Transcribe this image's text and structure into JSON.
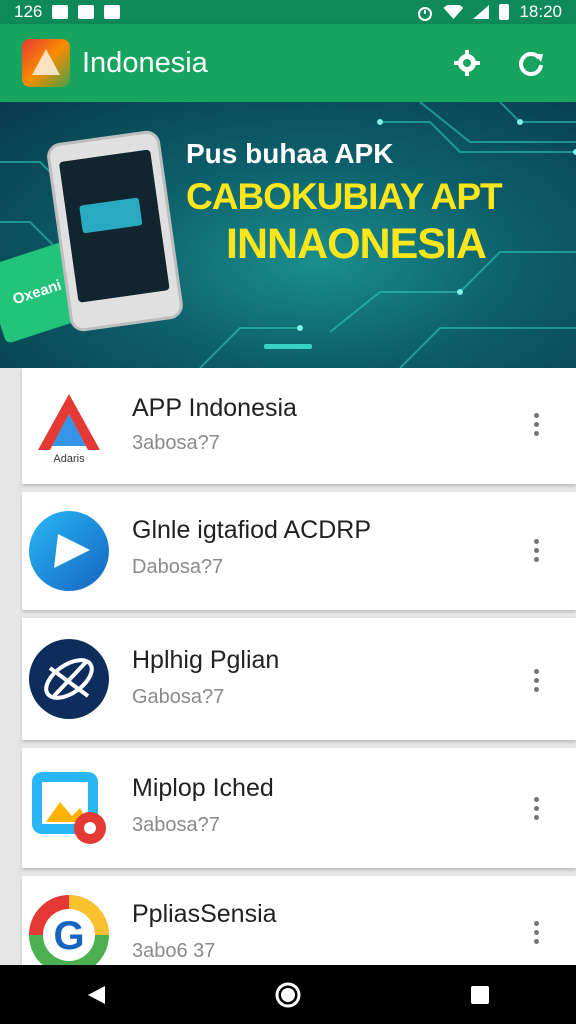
{
  "status_bar": {
    "left_text": "126",
    "time": "18:20",
    "icons": [
      "camera-icon",
      "photo-icon",
      "download-icon",
      "alarm-icon",
      "wifi-icon",
      "signal-icon",
      "battery-icon"
    ]
  },
  "app_bar": {
    "title": "Indonesia",
    "actions": [
      "settings-gear-icon",
      "refresh-icon"
    ],
    "colors": {
      "primary": "#16a45e",
      "status": "#0e8a5a"
    }
  },
  "banner": {
    "line1": "Pus buhaa APK",
    "line2": "CABOKUBIAY APT",
    "line3": "INNAONESIA",
    "card_label": "Oxeani",
    "colors": {
      "headline": "#ffe61a",
      "background": "#0d5f6b"
    }
  },
  "apps": [
    {
      "title": "APP Indonesia",
      "subtitle": "3abosa?7",
      "icon": "app-indonesia-logo-icon",
      "logo_text": "Adaris"
    },
    {
      "title": "Glnle igtafiod ACDRP",
      "subtitle": "Dabosa?7",
      "icon": "blue-play-icon"
    },
    {
      "title": "Hplhig Pglian",
      "subtitle": "Gabosa?7",
      "icon": "dark-globe-icon"
    },
    {
      "title": "Miplop Iched",
      "subtitle": "3abosa?7",
      "icon": "photo-editor-icon"
    },
    {
      "title": "PpliasSensia",
      "subtitle": "3abo6 37",
      "icon": "google-g-icon"
    }
  ],
  "nav": {
    "buttons": [
      "back-icon",
      "home-icon",
      "recents-icon"
    ]
  }
}
